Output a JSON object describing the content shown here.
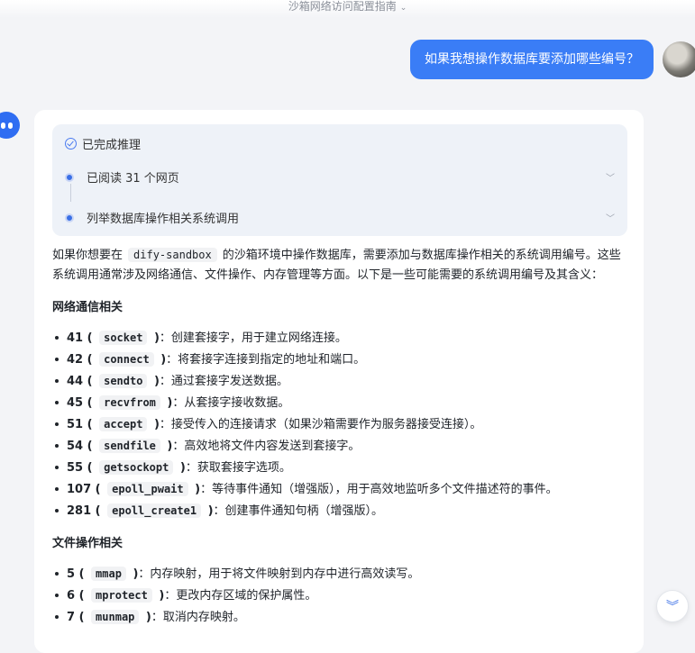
{
  "header": {
    "title": "沙箱网络访问配置指南",
    "chevron": "⌄"
  },
  "user_message": "如果我想操作数据库要添加哪些编号？",
  "reasoning": {
    "status": "已完成推理",
    "steps": [
      {
        "label": "已阅读 31 个网页"
      },
      {
        "label": "列举数据库操作相关系统调用"
      }
    ]
  },
  "answer": {
    "intro_before": "如果你想要在",
    "intro_code": "dify-sandbox",
    "intro_after": "的沙箱环境中操作数据库，需要添加与数据库操作相关的系统调用编号。这些系统调用通常涉及网络通信、文件操作、内存管理等方面。以下是一些可能需要的系统调用编号及其含义：",
    "sections": [
      {
        "title": "网络通信相关",
        "items": [
          {
            "num": "41",
            "call": "socket",
            "desc": "：创建套接字，用于建立网络连接。"
          },
          {
            "num": "42",
            "call": "connect",
            "desc": "：将套接字连接到指定的地址和端口。"
          },
          {
            "num": "44",
            "call": "sendto",
            "desc": "：通过套接字发送数据。"
          },
          {
            "num": "45",
            "call": "recvfrom",
            "desc": "：从套接字接收数据。"
          },
          {
            "num": "51",
            "call": "accept",
            "desc": "：接受传入的连接请求（如果沙箱需要作为服务器接受连接）。"
          },
          {
            "num": "54",
            "call": "sendfile",
            "desc": "：高效地将文件内容发送到套接字。"
          },
          {
            "num": "55",
            "call": "getsockopt",
            "desc": "：获取套接字选项。"
          },
          {
            "num": "107",
            "call": "epoll_pwait",
            "desc": "：等待事件通知（增强版），用于高效地监听多个文件描述符的事件。"
          },
          {
            "num": "281",
            "call": "epoll_create1",
            "desc": "：创建事件通知句柄（增强版）。"
          }
        ]
      },
      {
        "title": "文件操作相关",
        "items": [
          {
            "num": "5",
            "call": "mmap",
            "desc": "：内存映射，用于将文件映射到内存中进行高效读写。"
          },
          {
            "num": "6",
            "call": "mprotect",
            "desc": "：更改内存区域的保护属性。"
          },
          {
            "num": "7",
            "call": "munmap",
            "desc": "：取消内存映射。"
          }
        ]
      }
    ]
  },
  "scroll_button": {
    "icon": "double-chevron-down-icon",
    "glyph": "︾"
  },
  "colors": {
    "accent": "#3a7df6",
    "reasoning_bg": "#eef2f8"
  }
}
